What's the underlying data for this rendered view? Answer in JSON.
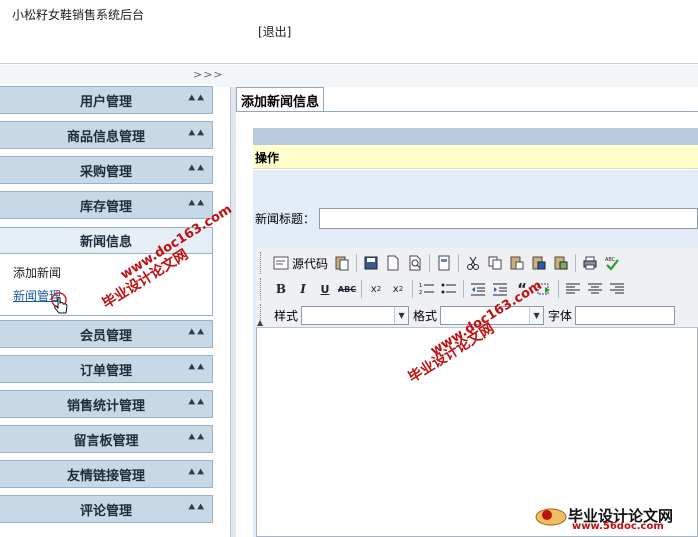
{
  "header": {
    "app_title": "小松籽女鞋销售系统后台",
    "logout_label": "[退出]",
    "collapse_label": ">>>"
  },
  "sidebar": {
    "items_top": [
      {
        "label": "用户管理"
      },
      {
        "label": "商品信息管理"
      },
      {
        "label": "采购管理"
      },
      {
        "label": "库存管理"
      }
    ],
    "open_section": {
      "label": "新闻信息",
      "links": [
        {
          "label": "添加新闻"
        },
        {
          "label": "新闻管理"
        }
      ]
    },
    "items_bottom": [
      {
        "label": "会员管理"
      },
      {
        "label": "订单管理"
      },
      {
        "label": "销售统计管理"
      },
      {
        "label": "留言板管理"
      },
      {
        "label": "友情链接管理"
      },
      {
        "label": "评论管理"
      }
    ]
  },
  "tab": {
    "label": "添加新闻信息"
  },
  "form": {
    "op_label": "操作",
    "title_label": "新闻标题：",
    "title_value": ""
  },
  "editor": {
    "source_label": "源代码",
    "style_label": "样式",
    "format_label": "格式",
    "font_label": "字体",
    "style_value": "",
    "format_value": "",
    "font_value": ""
  },
  "watermark": {
    "site_cn": "毕业设计论文网",
    "site_url": "www.doc163.com",
    "logo_text": "毕业设计论文网",
    "logo_url": "www.56doc.com"
  },
  "colors": {
    "menu_bg": "#c7d9e6",
    "panel_bar": "#b8cbe0",
    "op_row": "#ffffcc",
    "form_bg": "#e4ecf7",
    "watermark": "#c01010"
  }
}
